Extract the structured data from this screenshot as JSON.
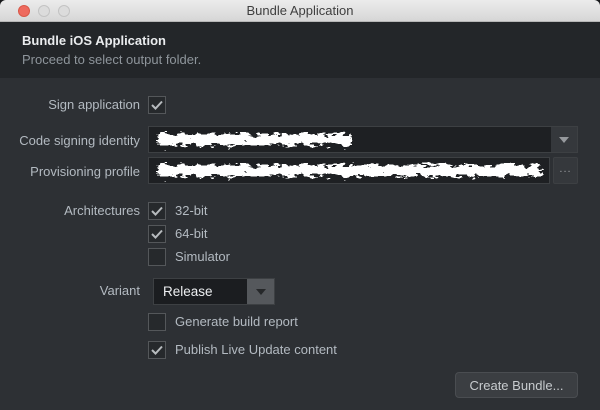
{
  "window": {
    "title": "Bundle Application"
  },
  "titlebar": {
    "close_button": "close-window",
    "minimize_button": "minimize-disabled",
    "zoom_button": "zoom-disabled"
  },
  "header": {
    "title": "Bundle iOS Application",
    "subtitle": "Proceed to select output folder."
  },
  "form": {
    "sign": {
      "label": "Sign application",
      "checked": true
    },
    "code_signing": {
      "label": "Code signing identity",
      "value_redacted": true
    },
    "provisioning": {
      "label": "Provisioning profile",
      "value_redacted": true,
      "browse_label": "..."
    },
    "architectures": {
      "label": "Architectures",
      "options": [
        {
          "label": "32-bit",
          "checked": true
        },
        {
          "label": "64-bit",
          "checked": true
        },
        {
          "label": "Simulator",
          "checked": false
        }
      ]
    },
    "variant": {
      "label": "Variant",
      "value": "Release"
    },
    "generate_report": {
      "label": "Generate build report",
      "checked": false
    },
    "publish_live_update": {
      "label": "Publish Live Update content",
      "checked": true
    }
  },
  "footer": {
    "create_button_label": "Create Bundle..."
  },
  "colors": {
    "close_red": "#ee6a5e",
    "titlebar_bg": "#e0e0e0",
    "header_panel_bg": "#232629",
    "form_bg": "#2d3034",
    "field_bg": "#1e2023",
    "label_text": "#b3bac1",
    "redaction": "#ffffff"
  }
}
